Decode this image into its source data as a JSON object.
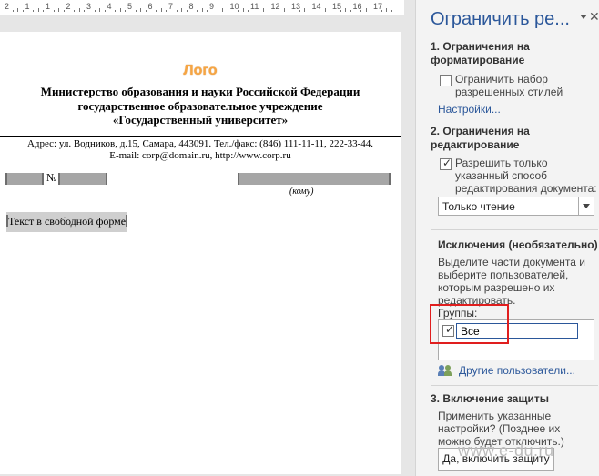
{
  "ruler": {
    "numbers": [
      "2",
      "1",
      "1",
      "2",
      "3",
      "4",
      "5",
      "6",
      "7",
      "8",
      "9",
      "10",
      "11",
      "12",
      "13",
      "14",
      "15",
      "16",
      "17"
    ]
  },
  "document": {
    "logo": "Лого",
    "header_lines": [
      "Министерство образования и науки Российской Федерации",
      "государственное образовательное учреждение",
      "«Государственный университет»"
    ],
    "address_lines": [
      "Адрес: ул. Водников, д.15, Самара, 443091. Тел./факс: (846) 111-11-11, 222-33-44.",
      "E-mail: corp@domain.ru, http://www.corp.ru"
    ],
    "number_sign": "№",
    "recipient_caption": "(кому)",
    "freeform_text": "Текст в свободной форме"
  },
  "pane": {
    "title": "Ограничить ре...",
    "section1": {
      "heading": "1. Ограничения на форматирование",
      "checkbox_label": "Ограничить набор разрешенных стилей",
      "checked": false,
      "settings_link": "Настройки..."
    },
    "section2": {
      "heading": "2. Ограничения на редактирование",
      "checkbox_label": "Разрешить только указанный способ редактирования документа:",
      "checked": true,
      "select_value": "Только чтение"
    },
    "exceptions": {
      "heading": "Исключения (необязательно)",
      "description": "Выделите части документа и выберите пользователей, которым разрешено их редактировать.",
      "groups_label": "Группы:",
      "group_name": "Все",
      "group_checked": true,
      "more_users_link": "Другие пользователи..."
    },
    "section3": {
      "heading": "3. Включение защиты",
      "description": "Применить указанные настройки? (Позднее их можно будет отключить.)",
      "button_label": "Да, включить защиту"
    },
    "watermark": "www.e-du.ru"
  },
  "colors": {
    "accent": "#2b579a",
    "highlight": "#e01e1e",
    "logo": "#f7a542"
  }
}
